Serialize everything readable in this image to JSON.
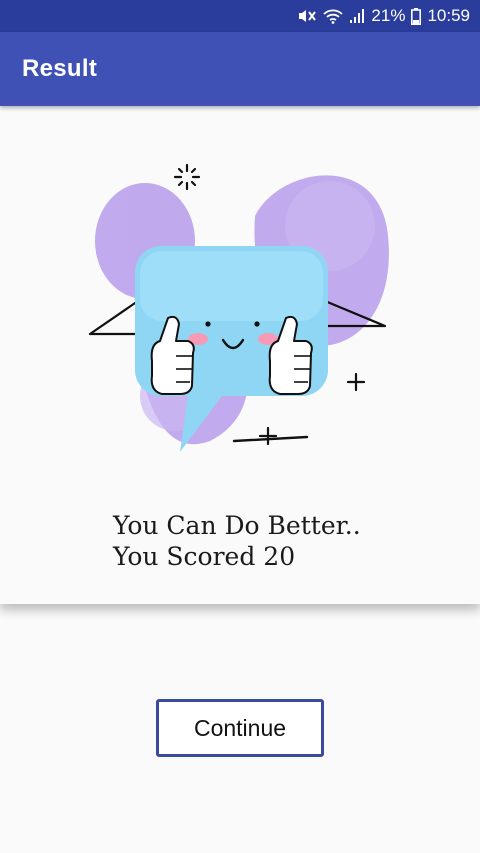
{
  "status_bar": {
    "battery_percent": "21%",
    "time": "10:59",
    "icons": [
      "mute-icon",
      "wifi-icon",
      "signal-icon",
      "battery-icon"
    ]
  },
  "app_bar": {
    "title": "Result"
  },
  "result": {
    "illustration": "happy-speech-bubble-thumbs-up-icon",
    "message": "You Can Do Better..",
    "score_text": "You Scored 20"
  },
  "actions": {
    "continue_label": "Continue"
  },
  "colors": {
    "status_bar": "#2b3d9c",
    "app_bar": "#3f51b5",
    "button_border": "#3b4a9a",
    "bubble": "#8fd6f5",
    "blob": "#b69bea"
  }
}
